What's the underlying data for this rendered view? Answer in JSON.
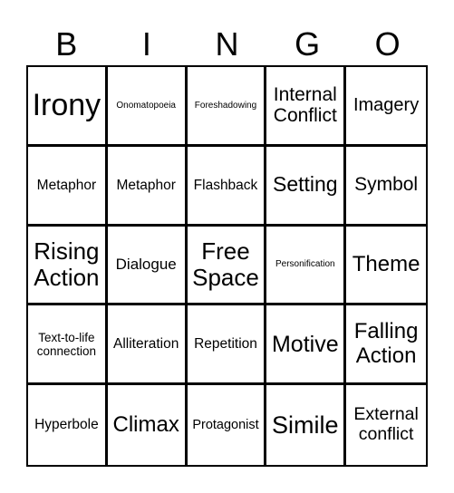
{
  "header": {
    "letters": [
      "B",
      "I",
      "N",
      "G",
      "O"
    ]
  },
  "board": {
    "rows": [
      [
        "Irony",
        "Onomatopoeia",
        "Foreshadowing",
        "Internal Conflict",
        "Imagery"
      ],
      [
        "Metaphor",
        "Metaphor",
        "Flashback",
        "Setting",
        "Symbol"
      ],
      [
        "Rising Action",
        "Dialogue",
        "Free Space",
        "Personification",
        "Theme"
      ],
      [
        "Text-to-life connection",
        "Alliteration",
        "Repetition",
        "Motive",
        "Falling Action"
      ],
      [
        "Hyperbole",
        "Climax",
        "Protagonist",
        "Simile",
        "External conflict"
      ]
    ]
  },
  "colors": {
    "grid_line": "#000000",
    "background": "#ffffff",
    "text": "#000000"
  }
}
